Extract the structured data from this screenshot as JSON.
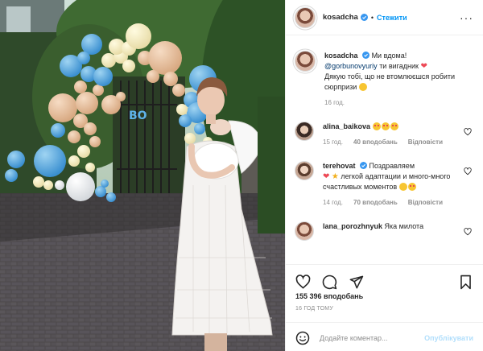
{
  "post": {
    "username": "kosadcha",
    "follow_label": "Стежити",
    "separator": "•",
    "more_label": "···"
  },
  "caption": {
    "username": "kosadcha",
    "text_before_mention": "Ми вдома!",
    "mention": "@gorbunovyuriy",
    "text_after_mention": "ти вигадник",
    "text_line2": "Дякую тобі, що не втомлюєшся робити сюрпризи",
    "time": "16 год."
  },
  "comments": [
    {
      "username": "alina_baikova",
      "time": "15 год.",
      "likes": "40 вподобань",
      "reply_label": "Відповісти"
    },
    {
      "username": "terehovat",
      "text_part1": "Поздравляем",
      "text_part2": "легкой адаптации и много-много счастливых моментов",
      "time": "14 год.",
      "likes": "70 вподобань",
      "reply_label": "Відповісти"
    },
    {
      "username": "lana_porozhnyuk",
      "text": "Яка милота"
    }
  ],
  "footer": {
    "likes_count": "155 396 вподобань",
    "time_ago": "16 ГОД ТОМУ",
    "comment_placeholder": "Додайте коментар...",
    "post_label": "Опублікувати"
  },
  "colors": {
    "accent": "#0095f6",
    "post_disabled": "#b2dffc",
    "muted": "#8e8e8e",
    "heart": "#ed4956"
  }
}
